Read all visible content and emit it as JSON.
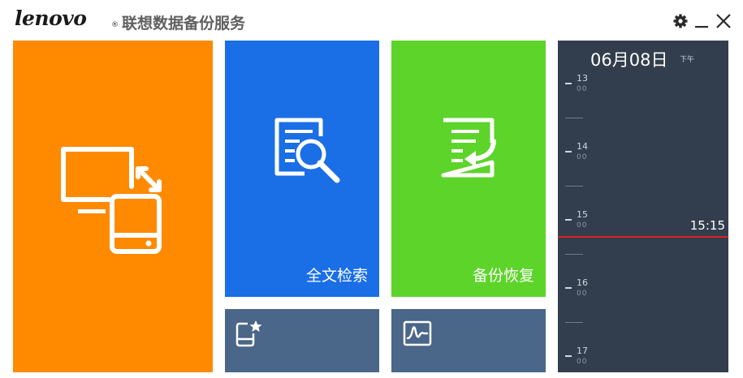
{
  "header": {
    "logo": "lenovo",
    "logo_mark": "®",
    "title": "联想数据备份服务",
    "gear_icon": "gear-icon",
    "minimize_icon": "minimize-icon",
    "close_icon": "close-icon"
  },
  "tiles": {
    "backup": {
      "icon": "computer-sync-disk-icon",
      "color": "#ff8a00"
    },
    "search": {
      "label": "全文检索",
      "icon": "document-search-icon",
      "color": "#1a6ee6"
    },
    "restore": {
      "label": "备份恢复",
      "icon": "document-restore-icon",
      "color": "#5dd42a"
    },
    "favorite": {
      "icon": "disk-star-icon",
      "color": "#4a6688"
    },
    "monitor": {
      "icon": "waveform-icon",
      "color": "#4a6688"
    }
  },
  "timeline": {
    "date": "06月08日",
    "ampm": "下午",
    "hours": [
      {
        "h": "13",
        "m": "00"
      },
      {
        "h": "14",
        "m": "00"
      },
      {
        "h": "15",
        "m": "00"
      },
      {
        "h": "16",
        "m": "00"
      },
      {
        "h": "17",
        "m": "00"
      }
    ],
    "current_time": "15:15",
    "current_color": "#e0201e",
    "background": "#323e4d"
  }
}
